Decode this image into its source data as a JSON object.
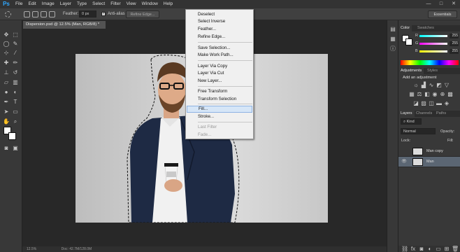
{
  "app": {
    "logo": "Ps"
  },
  "menubar": {
    "items": [
      "File",
      "Edit",
      "Image",
      "Layer",
      "Type",
      "Select",
      "Filter",
      "View",
      "Window",
      "Help"
    ],
    "window_controls": [
      "—",
      "□",
      "✕"
    ]
  },
  "options": {
    "feather_label": "Feather:",
    "feather_value": "0 px",
    "antialias_label": "Anti-alias",
    "refine_label": "Refine Edge...",
    "workspace": "Essentials"
  },
  "document": {
    "tab_title": "Dispersion.psd @ 12.5% (Man, RGB/8) *",
    "status_zoom": "12.5%",
    "status_doc": "Doc: 42.7M/128.0M"
  },
  "context_menu": {
    "items": [
      {
        "label": "Deselect",
        "enabled": true
      },
      {
        "label": "Select Inverse",
        "enabled": true
      },
      {
        "label": "Feather...",
        "enabled": true
      },
      {
        "label": "Refine Edge...",
        "enabled": true
      },
      {
        "label": "Save Selection...",
        "enabled": true
      },
      {
        "label": "Make Work Path...",
        "enabled": true
      },
      {
        "label": "Layer Via Copy",
        "enabled": true
      },
      {
        "label": "Layer Via Cut",
        "enabled": true
      },
      {
        "label": "New Layer...",
        "enabled": true
      },
      {
        "label": "Free Transform",
        "enabled": true
      },
      {
        "label": "Transform Selection",
        "enabled": true
      },
      {
        "label": "Fill...",
        "enabled": true,
        "highlighted": true
      },
      {
        "label": "Stroke...",
        "enabled": true
      },
      {
        "label": "Last Filter",
        "enabled": false
      },
      {
        "label": "Fade...",
        "enabled": false
      }
    ]
  },
  "color_panel": {
    "tabs": [
      "Color",
      "Swatches"
    ],
    "channels": [
      {
        "label": "R",
        "value": "255"
      },
      {
        "label": "G",
        "value": "255"
      },
      {
        "label": "B",
        "value": "255"
      }
    ]
  },
  "adjustments_panel": {
    "tabs": [
      "Adjustments",
      "Styles"
    ],
    "heading": "Add an adjustment"
  },
  "layers_panel": {
    "tabs": [
      "Layers",
      "Channels",
      "Paths"
    ],
    "kind_label": "Kind",
    "blend_mode": "Normal",
    "opacity_label": "Opacity:",
    "lock_label": "Lock:",
    "fill_label": "Fill:",
    "layers": [
      {
        "name": "Man copy",
        "visible": false,
        "selected": false
      },
      {
        "name": "Man",
        "visible": true,
        "selected": true
      }
    ]
  },
  "colors": {
    "accent": "#31a8ff",
    "menu_highlight": "#d6e6f7"
  }
}
